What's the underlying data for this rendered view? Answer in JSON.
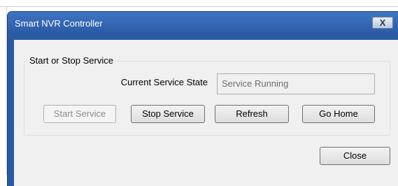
{
  "window": {
    "title": "Smart NVR Controller",
    "close_glyph": "X"
  },
  "group": {
    "legend": "Start or Stop Service"
  },
  "service_state": {
    "label": "Current Service State",
    "value": "Service Running"
  },
  "buttons": {
    "start": "Start Service",
    "stop": "Stop Service",
    "refresh": "Refresh",
    "home": "Go Home",
    "close": "Close"
  },
  "colors": {
    "titlebar": "#2a5aa3",
    "client": "#f0f0f0"
  }
}
